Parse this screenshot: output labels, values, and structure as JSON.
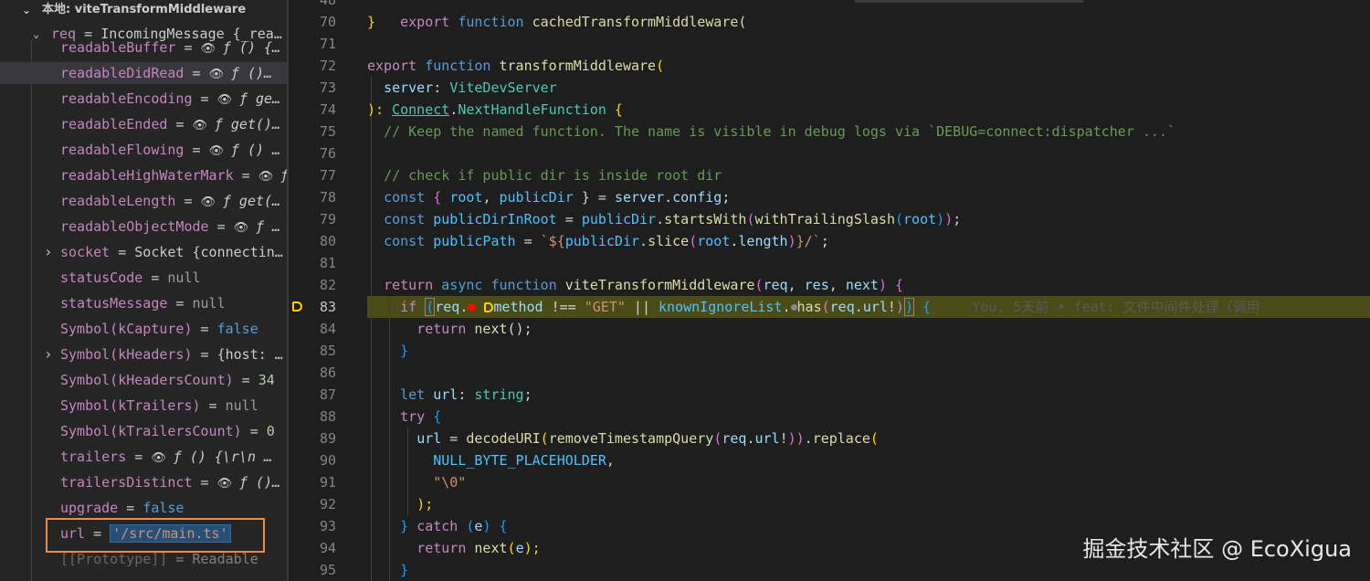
{
  "variables": {
    "section_title": "本地: viteTransformMiddleware",
    "req": {
      "name": "req",
      "value": "IncomingMessage {_rea…"
    },
    "rows": [
      {
        "name": "readableBuffer",
        "eye": true,
        "value": "ƒ () {…",
        "cut": true
      },
      {
        "name": "readableDidRead",
        "eye": true,
        "value": "ƒ ()…",
        "selected": true
      },
      {
        "name": "readableEncoding",
        "eye": true,
        "value": "ƒ ge…"
      },
      {
        "name": "readableEnded",
        "eye": true,
        "value": "ƒ get()…"
      },
      {
        "name": "readableFlowing",
        "eye": true,
        "value": "ƒ () …"
      },
      {
        "name": "readableHighWaterMark",
        "eye": true,
        "value": "ƒ"
      },
      {
        "name": "readableLength",
        "eye": true,
        "value": "ƒ get(…"
      },
      {
        "name": "readableObjectMode",
        "eye": true,
        "value": "ƒ …"
      },
      {
        "name": "socket",
        "expandable": true,
        "value": "Socket {connectin…"
      },
      {
        "name": "statusCode",
        "value": "null",
        "kind": "null"
      },
      {
        "name": "statusMessage",
        "value": "null",
        "kind": "null"
      },
      {
        "name": "Symbol(kCapture)",
        "value": "false",
        "kind": "bool"
      },
      {
        "name": "Symbol(kHeaders)",
        "expandable": true,
        "value": "{host: …"
      },
      {
        "name": "Symbol(kHeadersCount)",
        "value": "34",
        "kind": "num"
      },
      {
        "name": "Symbol(kTrailers)",
        "value": "null",
        "kind": "null"
      },
      {
        "name": "Symbol(kTrailersCount)",
        "value": "0",
        "kind": "num"
      },
      {
        "name": "trailers",
        "eye": true,
        "value": "ƒ () {\\r\\n  …"
      },
      {
        "name": "trailersDistinct",
        "eye": true,
        "value": "ƒ ()…"
      },
      {
        "name": "upgrade",
        "value": "false",
        "kind": "bool"
      },
      {
        "name": "url",
        "value": "'/src/main.ts'",
        "kind": "str",
        "boxed": true
      },
      {
        "name": "[[Prototype]]",
        "value": "Readable",
        "dim": true
      }
    ]
  },
  "editor": {
    "line_numbers": [
      "48",
      "70",
      "71",
      "72",
      "73",
      "74",
      "75",
      "76",
      "77",
      "78",
      "79",
      "80",
      "81",
      "82",
      "83",
      "84",
      "85",
      "86",
      "87",
      "88",
      "89",
      "90",
      "91",
      "92",
      "93",
      "94",
      "95"
    ],
    "active_line": "83",
    "l48": {
      "a": "export",
      "b": "function",
      "c": "cachedTransformMiddleware("
    },
    "l70": "}",
    "l72": {
      "a": "export",
      "b": "function",
      "c": "transformMiddleware",
      "d": "("
    },
    "l73": {
      "a": "server",
      "b": ": ",
      "c": "ViteDevServer"
    },
    "l74": {
      "a": "): ",
      "b": "Connect",
      "c": ".",
      "d": "NextHandleFunction",
      "e": " {"
    },
    "l75": "// Keep the named function. The name is visible in debug logs via `DEBUG=connect:dispatcher ...`",
    "l77": "// check if public dir is inside root dir",
    "l78": {
      "a": "const",
      "b": " { ",
      "c": "root",
      "d": ", ",
      "e": "publicDir",
      "f": " } = ",
      "g": "server",
      "h": ".",
      "i": "config",
      "j": ";"
    },
    "l79": {
      "a": "const",
      "b": "publicDirInRoot",
      "c": " = ",
      "d": "publicDir",
      "e": ".",
      "f": "startsWith",
      "g": "(",
      "h": "withTrailingSlash",
      "i": "(",
      "j": "root",
      "k": ")",
      "l": ")",
      "m": ";"
    },
    "l80": {
      "a": "const",
      "b": "publicPath",
      "c": " = ",
      "d": "`${",
      "e": "publicDir",
      "f": ".",
      "g": "slice",
      "h": "(",
      "i": "root",
      "j": ".",
      "k": "length",
      "l": ")",
      "m": "}/`",
      "n": ";"
    },
    "l82": {
      "a": "return",
      "b": "async",
      "c": "function",
      "d": "viteTransformMiddleware",
      "e": "(",
      "f": "req",
      "g": ", ",
      "h": "res",
      "i": ", ",
      "j": "next",
      "k": ")",
      "l": " {"
    },
    "l83": {
      "a": "if",
      "b": "(",
      "c": "req",
      "d": ".",
      "e": "method",
      "f": " !== ",
      "g": "\"GET\"",
      "h": " || ",
      "i": "knownIgnoreList",
      "j": ".",
      "k": "has",
      "l": "(",
      "m": "req",
      "n": ".",
      "o": "url",
      "p": "!",
      "q": ")",
      "r": ")",
      "s": " {",
      "blame": "You, 5天前 • feat: 文件中间件处理（调用"
    },
    "l84": {
      "a": "return",
      "b": "next",
      "c": "();"
    },
    "l85": "}",
    "l87": {
      "a": "let",
      "b": "url",
      "c": ": ",
      "d": "string",
      "e": ";"
    },
    "l88": {
      "a": "try",
      "b": " {"
    },
    "l89": {
      "a": "url",
      "b": " = ",
      "c": "decodeURI",
      "d": "(",
      "e": "removeTimestampQuery",
      "f": "(",
      "g": "req",
      "h": ".",
      "i": "url",
      "j": "!",
      "k": "))",
      "l": ".",
      "m": "replace",
      "n": "("
    },
    "l90": {
      "a": "NULL_BYTE_PLACEHOLDER",
      "b": ","
    },
    "l91": "\"\\0\"",
    "l92": ");",
    "l93": {
      "a": "}",
      "b": "catch",
      "c": " (",
      "d": "e",
      "e": ") {"
    },
    "l94": {
      "a": "return",
      "b": "next",
      "c": "(",
      "d": "e",
      "e": ");"
    },
    "l95": "}"
  },
  "watermark": "掘金技术社区 @ EcoXigua"
}
